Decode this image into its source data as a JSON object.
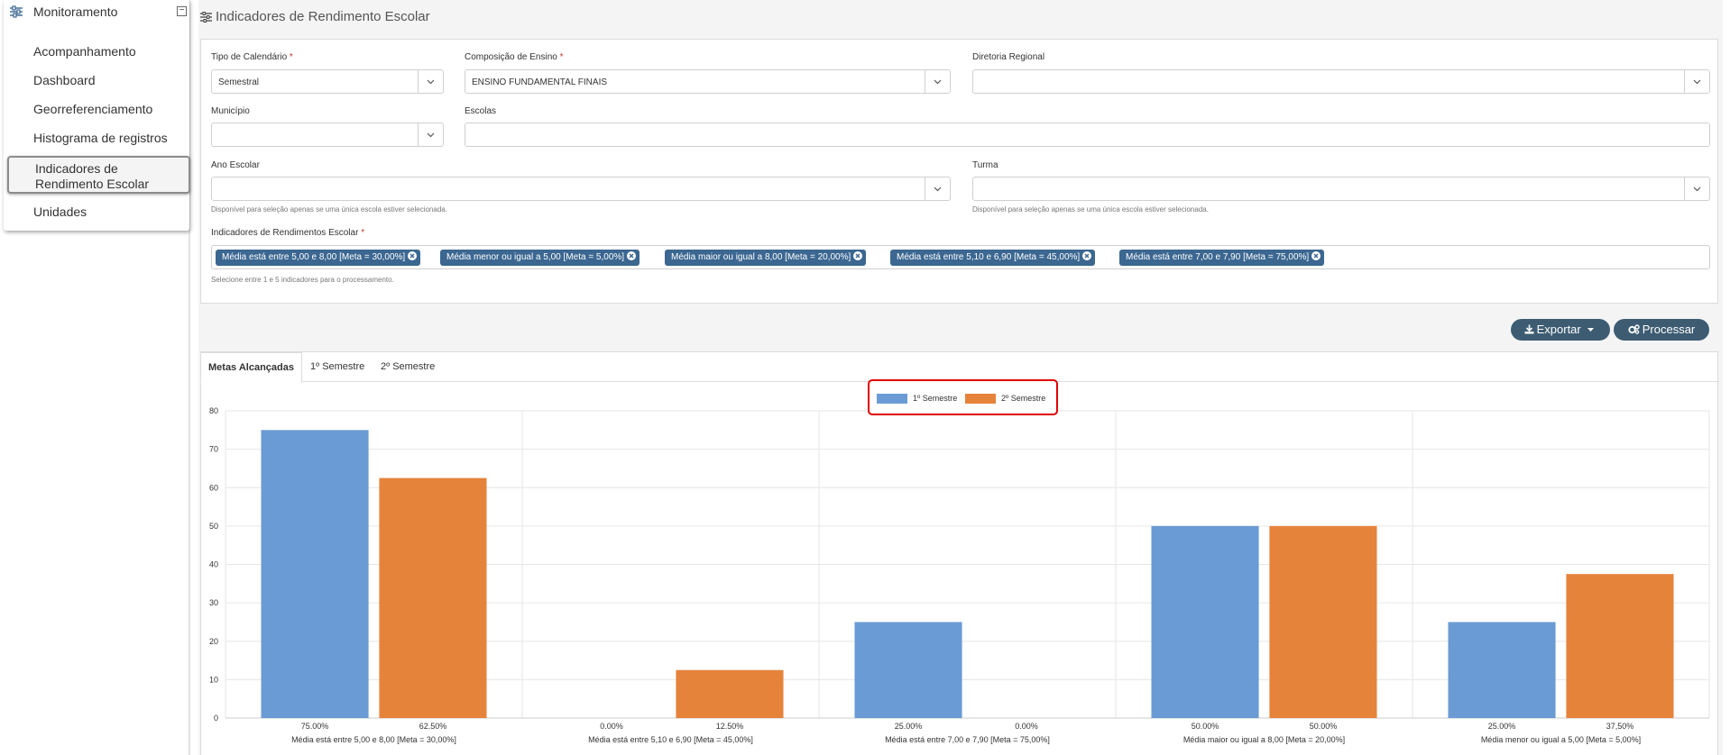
{
  "sidebar": {
    "title": "Monitoramento",
    "collapse_symbol": "⊟",
    "icon": "sliders-icon",
    "items": [
      {
        "label": "Acompanhamento"
      },
      {
        "label": "Dashboard"
      },
      {
        "label": "Georreferenciamento"
      },
      {
        "label": "Histograma de registros"
      },
      {
        "label": "Indicadores de Rendimento Escolar",
        "line1": "Indicadores de",
        "line2": "Rendimento Escolar",
        "active": true
      },
      {
        "label": "Unidades"
      }
    ]
  },
  "page": {
    "title": "Indicadores de Rendimento Escolar",
    "title_icon": "sliders-icon"
  },
  "filters": {
    "tipo_calendario": {
      "label": "Tipo de Calendário",
      "required": "*",
      "value": "Semestral"
    },
    "composicao_ensino": {
      "label": "Composição de Ensino",
      "required": "*",
      "value": "ENSINO FUNDAMENTAL FINAIS"
    },
    "diretoria_regional": {
      "label": "Diretoria Regional",
      "value": ""
    },
    "municipio": {
      "label": "Município",
      "value": ""
    },
    "escolas": {
      "label": "Escolas",
      "value": ""
    },
    "ano_escolar": {
      "label": "Ano Escolar",
      "value": "",
      "hint": "Disponível para seleção apenas se uma única escola estiver selecionada."
    },
    "turma": {
      "label": "Turma",
      "value": "",
      "hint": "Disponível para seleção apenas se uma única escola estiver selecionada."
    },
    "indicadores": {
      "label": "Indicadores de Rendimentos Escolar",
      "required": "*",
      "hint": "Selecione entre 1 e 5 indicadores para o processamento.",
      "tags": [
        "Média está entre 5,00 e 8,00 [Meta = 30,00%]",
        "Média menor ou igual a 5,00 [Meta = 5,00%]",
        "Média maior ou igual a 8,00 [Meta = 20,00%]",
        "Média está entre 5,10 e 6,90 [Meta = 45,00%]",
        "Média está entre 7,00 e 7,90 [Meta = 75,00%]"
      ]
    }
  },
  "actions": {
    "export_label": "Exportar",
    "process_label": "Processar"
  },
  "tabs": [
    {
      "label": "Metas Alcançadas",
      "active": true
    },
    {
      "label": "1º Semestre"
    },
    {
      "label": "2º Semestre"
    }
  ],
  "colors": {
    "series1": "#6a9bd4",
    "series2": "#e6833b",
    "tag_bg": "#3b6791",
    "button_bg": "#3d5c72",
    "legend_border": "#e00000"
  },
  "chart_data": {
    "type": "bar",
    "categories": [
      "Média está entre 5,00 e 8,00 [Meta = 30,00%]",
      "Média está entre 5,10 e 6,90 [Meta = 45,00%]",
      "Média está entre 7,00 e 7,90 [Meta = 75,00%]",
      "Média maior ou igual a 8,00 [Meta = 20,00%]",
      "Média menor ou igual a 5,00 [Meta = 5,00%]"
    ],
    "series": [
      {
        "name": "1º Semestre",
        "values": [
          75,
          0,
          25,
          50,
          25
        ],
        "labels": [
          "75.00%",
          "0.00%",
          "25.00%",
          "50.00%",
          "25.00%"
        ]
      },
      {
        "name": "2º Semestre",
        "values": [
          62.5,
          12.5,
          0,
          50,
          37.5
        ],
        "labels": [
          "62.50%",
          "12.50%",
          "0.00%",
          "50.00%",
          "37,50%"
        ]
      }
    ],
    "ylim": [
      0,
      80
    ],
    "yticks": [
      0,
      10,
      20,
      30,
      40,
      50,
      60,
      70,
      80
    ],
    "grid": true,
    "legend_position": "top-center"
  }
}
